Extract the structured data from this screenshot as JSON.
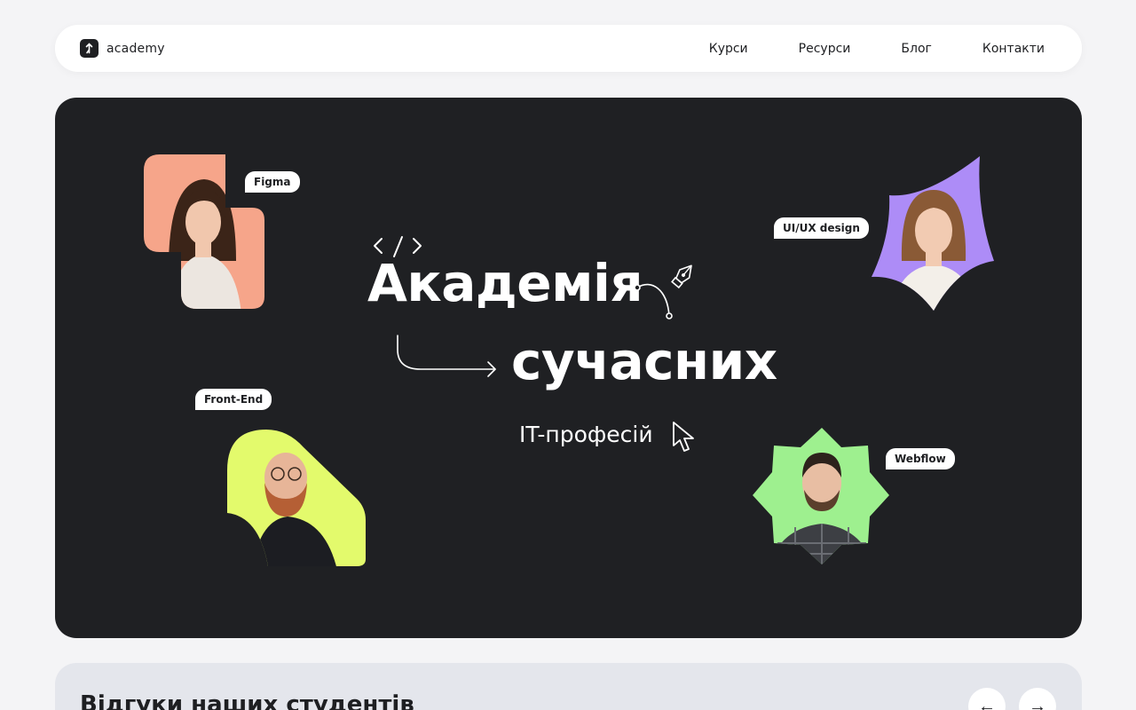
{
  "nav": {
    "logo_text": "academy",
    "links": [
      "Курси",
      "Ресурси",
      "Блог",
      "Контакти"
    ]
  },
  "hero": {
    "title_line1": "Академія",
    "title_line2": "сучасних",
    "subtitle": "IT-професій",
    "cards": [
      {
        "tag": "Figma",
        "accent": "#f6a58a",
        "icon": "portrait-woman-dark-hair"
      },
      {
        "tag": "UI/UX design",
        "accent": "#ad8cf7",
        "icon": "portrait-woman-smiling"
      },
      {
        "tag": "Front-End",
        "accent": "#e3fa6c",
        "icon": "portrait-man-beard-glasses"
      },
      {
        "tag": "Webflow",
        "accent": "#9ef08f",
        "icon": "portrait-man-plaid-shirt"
      }
    ]
  },
  "reviews": {
    "title": "Відгуки наших студентів",
    "prev_icon": "arrow-left-icon",
    "next_icon": "arrow-right-icon",
    "prev_glyph": "←",
    "next_glyph": "→"
  },
  "colors": {
    "hero_bg": "#1f2023",
    "page_bg": "#f4f4f6"
  }
}
